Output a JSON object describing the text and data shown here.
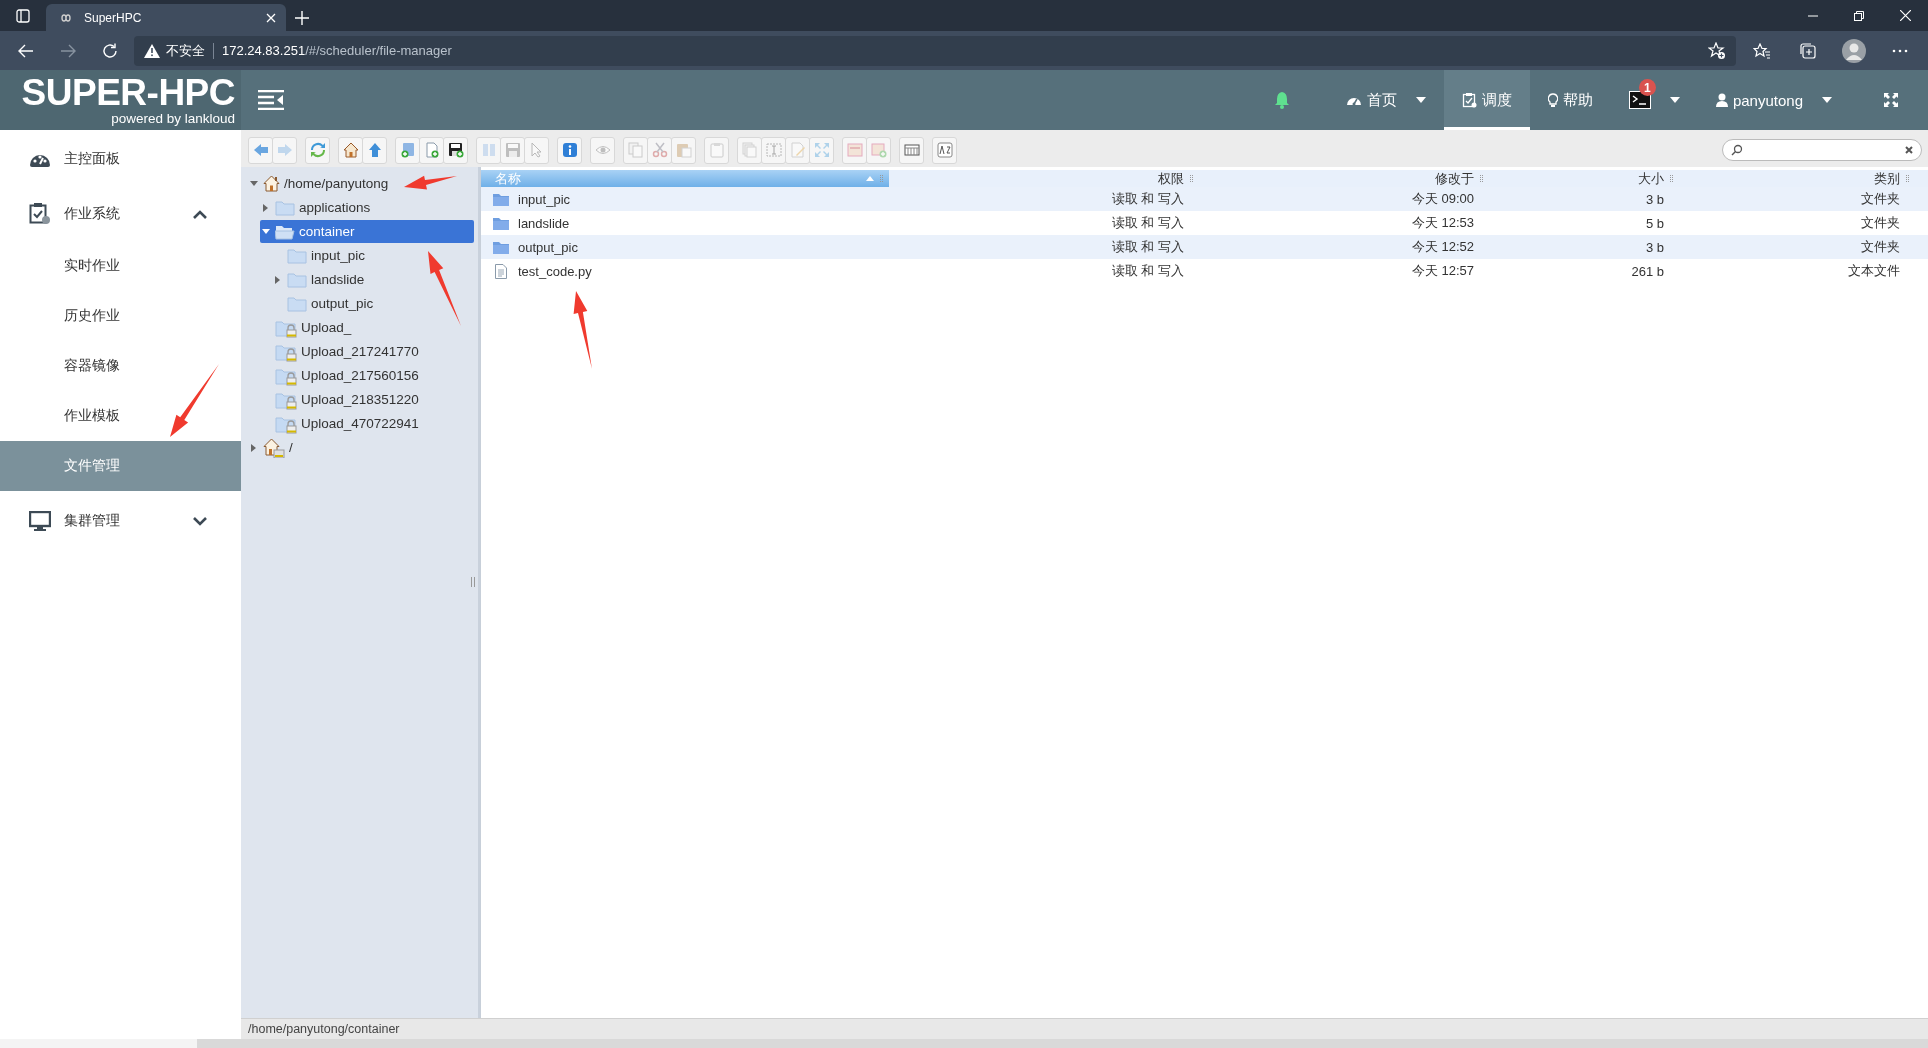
{
  "browser": {
    "tab_title": "SuperHPC",
    "security": "不安全",
    "url_host": "172.24.83.251",
    "url_path": "/#/scheduler/file-manager"
  },
  "header": {
    "logo": "SUPER-HPC",
    "logo_sub": "powered by lankloud",
    "nav": [
      {
        "kind": "bell"
      },
      {
        "kind": "link",
        "label": "首页",
        "dropdown": true,
        "selected": false
      },
      {
        "kind": "link",
        "label": "调度",
        "dropdown": false,
        "selected": true
      },
      {
        "kind": "link",
        "label": "帮助",
        "dropdown": false,
        "selected": false
      },
      {
        "kind": "terminal",
        "badge": "1",
        "dropdown": true
      },
      {
        "kind": "link",
        "label": "panyutong",
        "dropdown": true,
        "selected": false
      },
      {
        "kind": "fullscreen"
      }
    ]
  },
  "sidebar": {
    "items": [
      {
        "label": "主控面板",
        "selected": false
      },
      {
        "label": "作业系统",
        "selected": false,
        "expanded": true,
        "children": [
          {
            "label": "实时作业",
            "selected": false
          },
          {
            "label": "历史作业",
            "selected": false
          },
          {
            "label": "容器镜像",
            "selected": false
          },
          {
            "label": "作业模板",
            "selected": false
          },
          {
            "label": "文件管理",
            "selected": true
          }
        ]
      },
      {
        "label": "集群管理",
        "selected": false,
        "expanded": false
      }
    ]
  },
  "toolbar": [
    [
      {
        "kind": "back",
        "disabled": false
      },
      {
        "kind": "forward",
        "disabled": true
      }
    ],
    [
      {
        "kind": "reload",
        "disabled": false
      }
    ],
    [
      {
        "kind": "home",
        "disabled": false
      },
      {
        "kind": "up",
        "disabled": false
      }
    ],
    [
      {
        "kind": "mkdir",
        "disabled": false
      },
      {
        "kind": "mkfile",
        "disabled": false
      },
      {
        "kind": "upload",
        "disabled": false
      }
    ],
    [
      {
        "kind": "open",
        "disabled": true
      },
      {
        "kind": "save",
        "disabled": true
      },
      {
        "kind": "select",
        "disabled": true
      }
    ],
    [
      {
        "kind": "info",
        "disabled": false
      }
    ],
    [
      {
        "kind": "view",
        "disabled": true
      }
    ],
    [
      {
        "kind": "copy",
        "disabled": true
      },
      {
        "kind": "cut",
        "disabled": true
      },
      {
        "kind": "paste",
        "disabled": true
      }
    ],
    [
      {
        "kind": "rm",
        "disabled": true
      }
    ],
    [
      {
        "kind": "duplicate",
        "disabled": true
      },
      {
        "kind": "rename",
        "disabled": true
      },
      {
        "kind": "edit",
        "disabled": true
      },
      {
        "kind": "resize",
        "disabled": true
      }
    ],
    [
      {
        "kind": "archive",
        "disabled": true
      },
      {
        "kind": "extract",
        "disabled": true
      }
    ],
    [
      {
        "kind": "viewmode",
        "disabled": false
      }
    ],
    [
      {
        "kind": "sort",
        "disabled": false
      }
    ]
  ],
  "tree": [
    {
      "label": "/home/panyutong",
      "kind": "home",
      "expanded": true,
      "selected": false,
      "children": [
        {
          "label": "applications",
          "kind": "folder",
          "expanded": false,
          "selected": false
        },
        {
          "label": "container",
          "kind": "folder",
          "expanded": true,
          "selected": true,
          "children": [
            {
              "label": "input_pic",
              "kind": "folder",
              "selected": false
            },
            {
              "label": "landslide",
              "kind": "folder",
              "expanded": false,
              "selected": false
            },
            {
              "label": "output_pic",
              "kind": "folder",
              "selected": false
            }
          ]
        },
        {
          "label": "Upload_",
          "kind": "locked",
          "selected": false
        },
        {
          "label": "Upload_217241770",
          "kind": "locked",
          "selected": false
        },
        {
          "label": "Upload_217560156",
          "kind": "locked",
          "selected": false
        },
        {
          "label": "Upload_218351220",
          "kind": "locked",
          "selected": false
        },
        {
          "label": "Upload_470722941",
          "kind": "locked",
          "selected": false
        }
      ]
    },
    {
      "label": "/",
      "kind": "root-locked",
      "expanded": false,
      "selected": false
    }
  ],
  "columns": [
    {
      "label": "名称",
      "sorted": true
    },
    {
      "label": "权限",
      "sorted": false
    },
    {
      "label": "修改于",
      "sorted": false
    },
    {
      "label": "大小",
      "sorted": false
    },
    {
      "label": "类别",
      "sorted": false
    }
  ],
  "rows": [
    {
      "kind": "folder",
      "name": "input_pic",
      "permissions": "读取 和 写入",
      "modified": "今天 09:00",
      "size": "3 b",
      "type": "文件夹"
    },
    {
      "kind": "folder",
      "name": "landslide",
      "permissions": "读取 和 写入",
      "modified": "今天 12:53",
      "size": "5 b",
      "type": "文件夹"
    },
    {
      "kind": "folder",
      "name": "output_pic",
      "permissions": "读取 和 写入",
      "modified": "今天 12:52",
      "size": "3 b",
      "type": "文件夹"
    },
    {
      "kind": "file",
      "name": "test_code.py",
      "permissions": "读取 和 写入",
      "modified": "今天 12:57",
      "size": "261 b",
      "type": "文本文件"
    }
  ],
  "status_bar": {
    "path": "/home/panyutong/container"
  }
}
